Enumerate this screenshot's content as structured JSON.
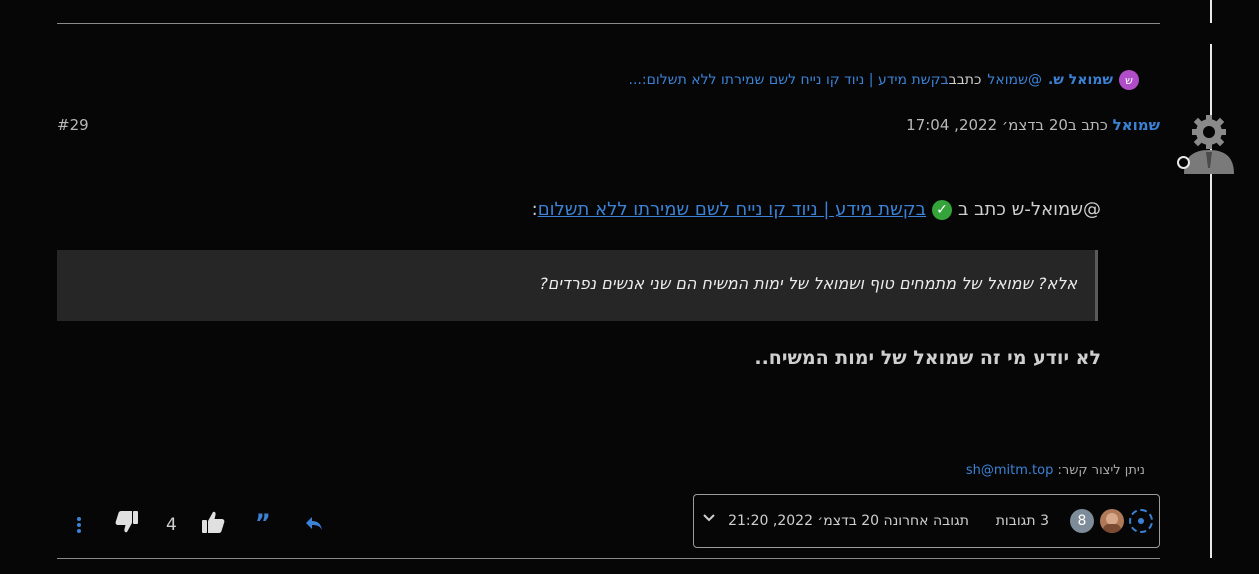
{
  "backlink": {
    "avatar_letter": "ש",
    "user": "שמואל ש.",
    "mention": "@שמואל",
    "verb": "כתב",
    "prefix": "ב",
    "topic": "בקשת מידע | ניוד קו נייח לשם שמירתו ללא תשלום:..."
  },
  "post": {
    "author": "שמואל",
    "written_in": "כתב ב20 בדצמ׳ 2022, 17:04",
    "index": "#29",
    "quote_intro_prefix": "@שמואל-ש כתב ב",
    "quote_link": "בקשת מידע | ניוד קו נייח לשם שמירתו ללא תשלום",
    "quote_suffix": ":",
    "blockquote": "אלא? שמואל של מתמחים טוף ושמואל של ימות המשיח הם שני אנשים נפרדים?",
    "body": "לא יודע מי זה שמואל של ימות המשיח..",
    "signature_label": "ניתן ליצור קשר:",
    "signature_email": "sh@mitm.top"
  },
  "thread_box": {
    "replies": "3 תגובות",
    "last_reply": "תגובה אחרונה 20 בדצמ׳ 2022, 21:20",
    "count_badge": "8"
  },
  "actions": {
    "votes": "4"
  },
  "icons": {
    "avatar": "user-gear-avatar-icon",
    "check": "check-mark-icon",
    "reply": "reply-arrow-icon",
    "quote": "quote-icon",
    "upvote": "thumbs-up-icon",
    "downvote": "thumbs-down-icon",
    "more": "more-vertical-icon",
    "expand": "chevron-down-icon"
  },
  "colors": {
    "link": "#3b82d6",
    "background": "#060606",
    "quote_bg": "#262626"
  }
}
